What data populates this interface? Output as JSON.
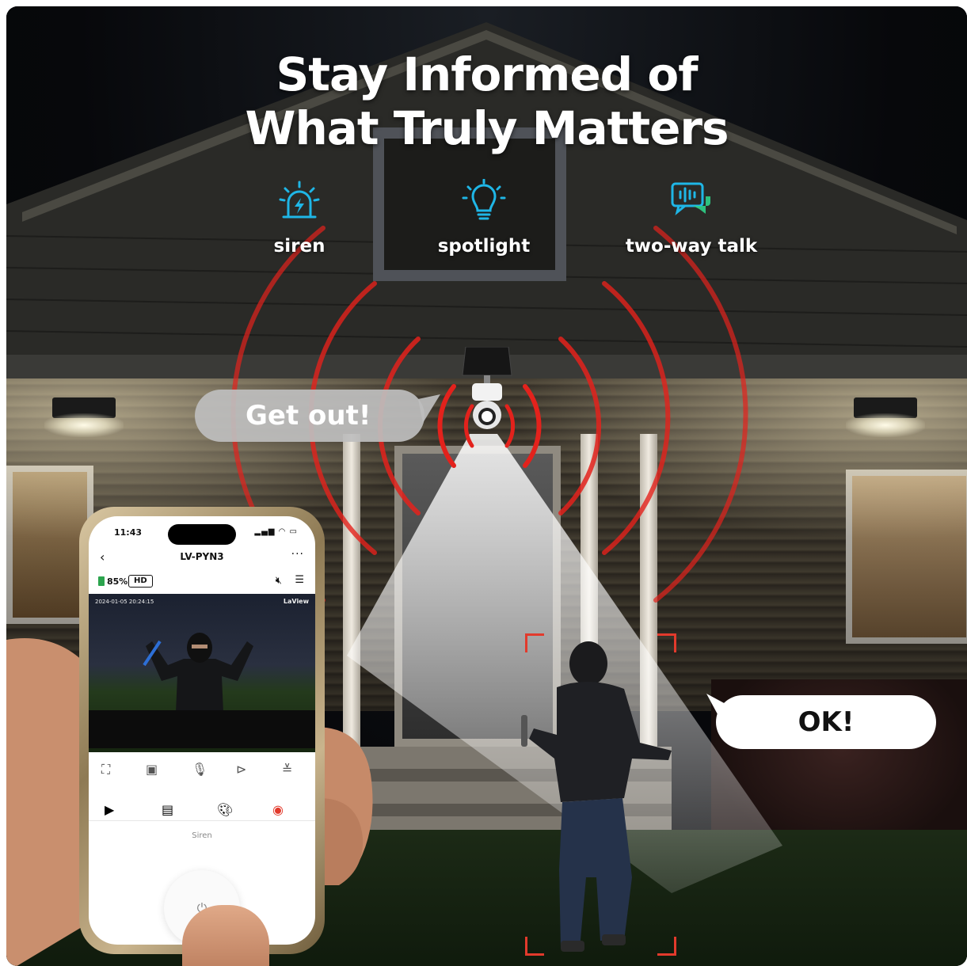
{
  "headline": {
    "line1": "Stay Informed of",
    "line2": "What Truly Matters"
  },
  "features": [
    {
      "label": "siren",
      "icon": "siren-icon"
    },
    {
      "label": "spotlight",
      "icon": "lightbulb-icon"
    },
    {
      "label": "two-way talk",
      "icon": "chat-bubble-icon"
    }
  ],
  "colors": {
    "accent": "#1fb6e6",
    "warning_red": "#e23a2c",
    "bubble_gray": "#bdbdbd"
  },
  "speech": {
    "camera_says": "Get out!",
    "intruder_says": "OK!"
  },
  "phone": {
    "status_time": "11:43",
    "device_title": "LV-PYN3",
    "battery": "85%",
    "quality": "HD",
    "timestamp": "2024-01-05 20:24:15",
    "watermark": "LaView",
    "siren_label": "Siren"
  }
}
